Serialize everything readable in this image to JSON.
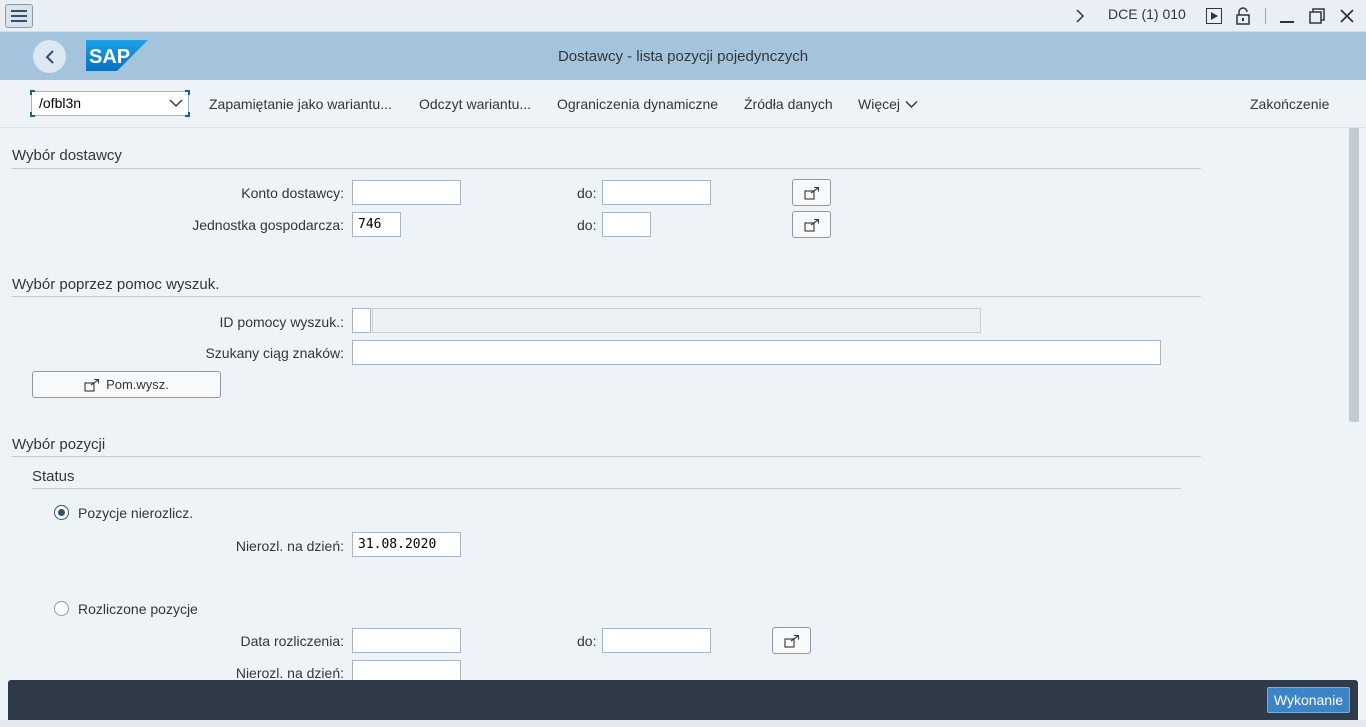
{
  "window": {
    "system": "DCE (1) 010"
  },
  "shell": {
    "title": "Dostawcy - lista pozycji pojedynczych",
    "logo_text": "SAP"
  },
  "toolbar": {
    "tcode_value": "/ofbl3n",
    "buttons": [
      "Zapamiętanie jako wariantu...",
      "Odczyt wariantu...",
      "Ograniczenia dynamiczne",
      "Źródła danych",
      "Więcej"
    ],
    "exit_label": "Zakończenie"
  },
  "vendor_selection": {
    "title": "Wybór dostawcy",
    "account_label": "Konto dostawcy:",
    "account_from": "",
    "account_to": "",
    "company_label": "Jednostka gospodarcza:",
    "company_from": "746",
    "company_to": "",
    "to_label": "do:"
  },
  "search_help": {
    "title": "Wybór poprzez pomoc wyszuk.",
    "id_label": "ID pomocy wyszuk.:",
    "id_value": "",
    "string_label": "Szukany ciąg znaków:",
    "string_value": "",
    "button_label": "Pom.wysz."
  },
  "item_selection": {
    "title": "Wybór pozycji",
    "status_title": "Status",
    "open_items_label": "Pozycje nierozlicz.",
    "open_items_selected": true,
    "open_key_date_label": "Nierozl. na dzień:",
    "open_key_date": "31.08.2020",
    "cleared_items_label": "Rozliczone pozycje",
    "cleared_items_selected": false,
    "clearing_date_label": "Data rozliczenia:",
    "clearing_from": "",
    "clearing_to": "",
    "to_label": "do:",
    "cleared_key_date_label": "Nierozl. na dzień:",
    "cleared_key_date": ""
  },
  "footer": {
    "execute_label": "Wykonanie"
  },
  "colors": {
    "shell": "#a4c3dd",
    "background": "#eef3f8",
    "footer": "#2f3b48",
    "primary_button": "#3d84c6"
  }
}
